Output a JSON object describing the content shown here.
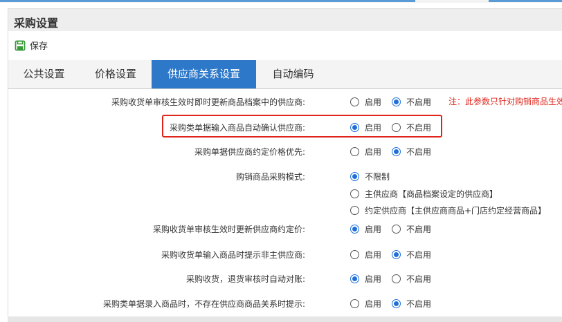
{
  "window": {
    "title": "采购设置"
  },
  "toolbar": {
    "save_label": "保存",
    "save_icon": "floppy-disk-icon",
    "save_icon_color": "#3a9a3a"
  },
  "tabs": [
    {
      "label": "公共设置"
    },
    {
      "label": "价格设置"
    },
    {
      "label": "供应商关系设置",
      "active": true
    },
    {
      "label": "自动编码"
    }
  ],
  "accent_color": "#2e78c9",
  "note": "注：此参数只针对购销商品生效",
  "settings": [
    {
      "label": "采购收货单审核生效时即时更新商品档案中的供应商:",
      "options": [
        "启用",
        "不启用"
      ],
      "selected": 1
    },
    {
      "label": "采购类单据输入商品自动确认供应商:",
      "options": [
        "启用",
        "不启用"
      ],
      "selected": 0,
      "highlighted": true
    },
    {
      "label": "采购单据供应商约定价格优先:",
      "options": [
        "启用",
        "不启用"
      ],
      "selected": 1
    },
    {
      "label": "购销商品采购模式:",
      "options": [
        "不限制",
        "主供应商【商品档案设定的供应商】",
        "约定供应商【主供应商商品+门店约定经营商品】"
      ],
      "selected": 0
    },
    {
      "label": "采购收货单审核生效时更新供应商约定价:",
      "options": [
        "启用",
        "不启用"
      ],
      "selected": 0
    },
    {
      "label": "采购收货单输入商品时提示非主供应商:",
      "options": [
        "启用",
        "不启用"
      ],
      "selected": 1
    },
    {
      "label": "采购收货，退货审核时自动对账:",
      "options": [
        "启用",
        "不启用"
      ],
      "selected": 0
    },
    {
      "label": "采购类单据录入商品时，不存在供应商商品关系时提示:",
      "options": [
        "启用",
        "不启用"
      ],
      "selected": 1
    }
  ]
}
